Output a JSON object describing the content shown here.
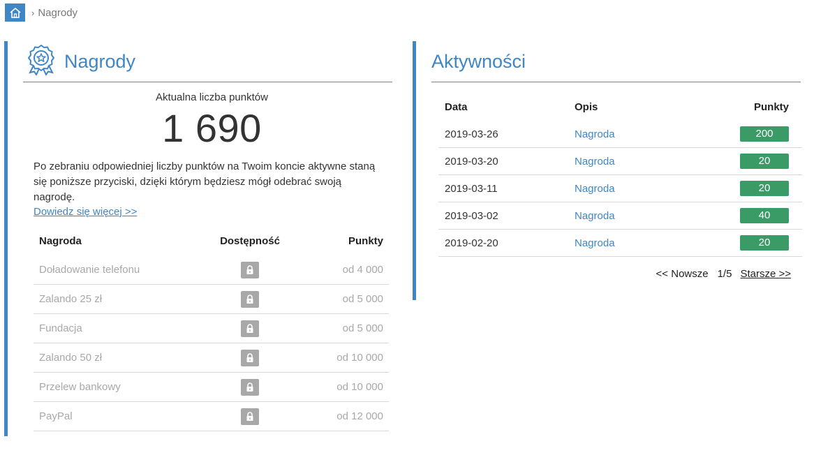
{
  "breadcrumb": {
    "current": "Nagrody",
    "separator": "›"
  },
  "rewards_panel": {
    "title": "Nagrody",
    "points_label": "Aktualna liczba punktów",
    "points_value": "1 690",
    "description": "Po zebraniu odpowiedniej liczby punktów na Twoim koncie aktywne staną się poniższe przyciski, dzięki którym będziesz mógł odebrać swoją nagrodę.",
    "learn_more": "Dowiedz się więcej >>",
    "table": {
      "headers": {
        "reward": "Nagroda",
        "availability": "Dostępność",
        "points": "Punkty"
      },
      "rows": [
        {
          "reward": "Doładowanie telefonu",
          "points": "od 4 000"
        },
        {
          "reward": "Zalando 25 zł",
          "points": "od 5 000"
        },
        {
          "reward": "Fundacja",
          "points": "od 5 000"
        },
        {
          "reward": "Zalando 50 zł",
          "points": "od 10 000"
        },
        {
          "reward": "Przelew bankowy",
          "points": "od 10 000"
        },
        {
          "reward": "PayPal",
          "points": "od 12 000"
        }
      ]
    }
  },
  "activities_panel": {
    "title": "Aktywności",
    "table": {
      "headers": {
        "date": "Data",
        "description": "Opis",
        "points": "Punkty"
      },
      "rows": [
        {
          "date": "2019-03-26",
          "description": "Nagroda",
          "points": "200"
        },
        {
          "date": "2019-03-20",
          "description": "Nagroda",
          "points": "20"
        },
        {
          "date": "2019-03-11",
          "description": "Nagroda",
          "points": "20"
        },
        {
          "date": "2019-03-02",
          "description": "Nagroda",
          "points": "40"
        },
        {
          "date": "2019-02-20",
          "description": "Nagroda",
          "points": "20"
        }
      ]
    },
    "pager": {
      "prev": "<< Nowsze",
      "page": "1/5",
      "next": "Starsze >>"
    }
  },
  "colors": {
    "accent": "#3e86c6",
    "badge": "#3a9b67",
    "lock": "#a8a8a8"
  },
  "icons": {
    "home": "home-icon",
    "medal": "medal-icon",
    "lock": "lock-icon"
  }
}
